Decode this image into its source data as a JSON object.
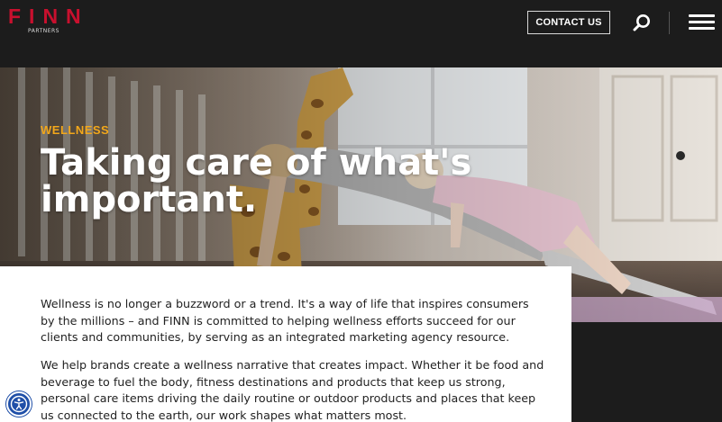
{
  "header": {
    "logo_text": "FINN",
    "logo_subtext": "PARTNERS",
    "contact_label": "CONTACT US"
  },
  "hero": {
    "category": "WELLNESS",
    "headline": "Taking care of what's important."
  },
  "content": {
    "paragraphs": [
      "Wellness is no longer a buzzword or a trend. It's a way of life that inspires consumers by the millions – and FINN is committed to helping wellness efforts succeed for our clients and communities, by serving as an integrated marketing agency resource.",
      "We help brands create a wellness narrative that creates impact. Whether it be food and beverage to fuel the body, fitness destinations and products that keep us strong, personal care items driving the daily routine or outdoor products and places that keep us connected to the earth, our work shapes what matters most."
    ]
  },
  "colors": {
    "brand_red": "#c8102e",
    "accent_orange": "#f2a71b",
    "header_bg": "#1c1c1c",
    "accessibility_blue": "#1f4fa8"
  },
  "icons": {
    "search": "search-icon",
    "menu": "menu-icon",
    "accessibility": "accessibility-icon"
  }
}
